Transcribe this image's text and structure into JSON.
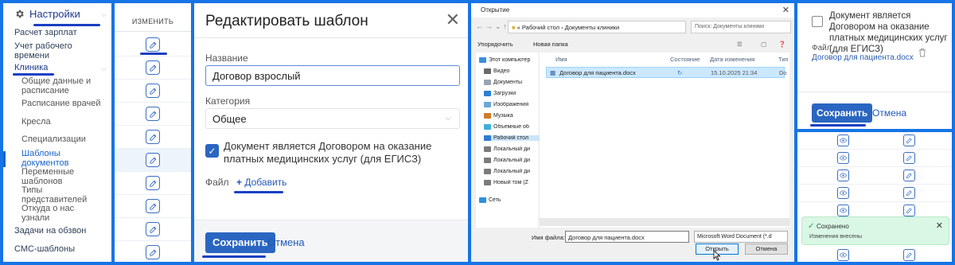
{
  "sidebar": {
    "header": "Настройки",
    "items": [
      {
        "label": "Расчет зарплат"
      },
      {
        "label": "Учет рабочего времени"
      },
      {
        "label": "Клиника"
      }
    ],
    "clinic_items": [
      {
        "label": "Общие данные и расписание"
      },
      {
        "label": "Расписание врачей"
      },
      {
        "label": "Кресла"
      },
      {
        "label": "Специализации"
      },
      {
        "label": "Шаблоны документов"
      },
      {
        "label": "Переменные шаблонов"
      },
      {
        "label": "Типы представителей"
      },
      {
        "label": "Откуда о нас узнали"
      }
    ],
    "bottom_items": [
      {
        "label": "Задачи на обзвон"
      },
      {
        "label": "СМС-шаблоны"
      }
    ]
  },
  "table": {
    "column_header": "ИЗМЕНИТЬ"
  },
  "modal": {
    "title": "Редактировать шаблон",
    "name_label": "Название",
    "name_value": "Договор взрослый",
    "category_label": "Категория",
    "category_value": "Общее",
    "checkbox_label": "Документ является Договором на оказание платных медицинских услуг (для ЕГИСЗ)",
    "file_label": "Файл",
    "add_label": "Добавить",
    "save_label": "Сохранить",
    "cancel_label": "Отмена"
  },
  "file_dialog": {
    "title": "Открытие",
    "path": [
      "Рабочий стол",
      "Документы клиники"
    ],
    "path_prefix": "«",
    "search_placeholder": "Поиск: Документы клиники",
    "organize_label": "Упорядочить",
    "new_folder_label": "Новая папка",
    "tree": [
      {
        "label": "Этот компьютер",
        "icon": "computer-icon"
      },
      {
        "label": "Видео",
        "icon": "video-icon"
      },
      {
        "label": "Документы",
        "icon": "documents-icon"
      },
      {
        "label": "Загрузки",
        "icon": "downloads-icon"
      },
      {
        "label": "Изображения",
        "icon": "images-icon"
      },
      {
        "label": "Музыка",
        "icon": "music-icon"
      },
      {
        "label": "Объемные об",
        "icon": "3d-objects-icon"
      },
      {
        "label": "Рабочий стол",
        "icon": "desktop-icon"
      },
      {
        "label": "Локальный ди",
        "icon": "drive-icon"
      },
      {
        "label": "Локальный ди",
        "icon": "drive-icon"
      },
      {
        "label": "Локальный ди",
        "icon": "drive-icon"
      },
      {
        "label": "Новый том (Z",
        "icon": "drive-icon"
      },
      {
        "label": "Сеть",
        "icon": "network-icon"
      }
    ],
    "columns": {
      "name": "Имя",
      "status": "Состояние",
      "date": "Дата изменения",
      "type": "Тип"
    },
    "files": [
      {
        "name": "Договор для пациента.docx",
        "date": "15.10.2025 21:34",
        "type": "Do"
      }
    ],
    "filename_label": "Имя файла:",
    "filename_value": "Договор для пациента.docx",
    "filetype_value": "Microsoft Word Document (*.d",
    "open_label": "Открыть",
    "cancel_label": "Отмена"
  },
  "form_bottom": {
    "checkbox_label": "Документ является Договором на оказание платных медицинских услуг (для ЕГИСЗ)",
    "file_label": "Файл",
    "file_name": "Договор для пациента.docx",
    "save_label": "Сохранить",
    "cancel_label": "Отмена"
  },
  "toast": {
    "title": "Сохранено",
    "description": "Изменения внесены"
  },
  "colors": {
    "accent": "#2a66c1",
    "frame": "#1674e6",
    "toast_bg": "#d9f7e4"
  }
}
